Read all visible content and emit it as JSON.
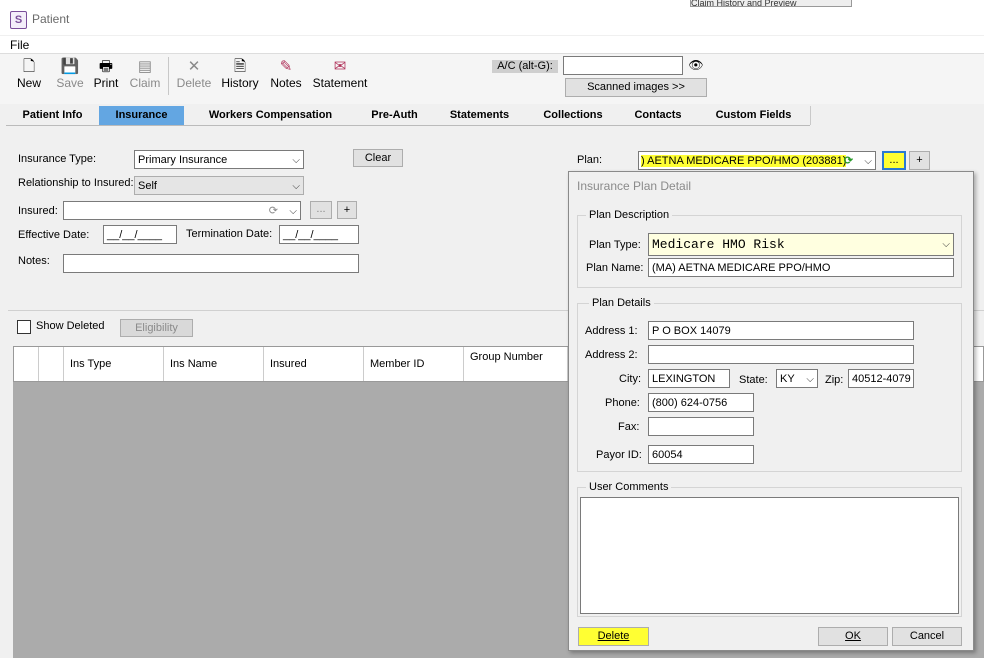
{
  "window": {
    "title": "Patient",
    "background_tab": "Claim History and Preview"
  },
  "menu": {
    "file": "File"
  },
  "toolbar": {
    "new": "New",
    "save": "Save",
    "print": "Print",
    "claim": "Claim",
    "delete": "Delete",
    "history": "History",
    "notes": "Notes",
    "statement": "Statement",
    "ac_label": "A/C (alt-G):",
    "ac_value": "",
    "scanned_images": "Scanned images >>"
  },
  "tabs": [
    "Patient Info",
    "Insurance",
    "Workers Compensation",
    "Pre-Auth",
    "Statements",
    "Collections",
    "Contacts",
    "Custom Fields"
  ],
  "active_tab": "Insurance",
  "form": {
    "insurance_type_label": "Insurance Type:",
    "insurance_type_value": "Primary Insurance",
    "clear_button": "Clear",
    "relationship_label": "Relationship to Insured:",
    "relationship_value": "Self",
    "insured_label": "Insured:",
    "insured_value": "",
    "effective_date_label": "Effective Date:",
    "effective_date_value": "__/__/____",
    "termination_date_label": "Termination Date:",
    "termination_date_value": "__/__/____",
    "notes_label": "Notes:",
    "notes_value": "",
    "plan_label": "Plan:",
    "plan_value": ") AETNA MEDICARE PPO/HMO (203881)",
    "ellipsis": "...",
    "plus": "+",
    "show_deleted_label": "Show Deleted",
    "eligibility_button": "Eligibility"
  },
  "grid": {
    "columns": [
      "",
      "",
      "Ins Type",
      "Ins Name",
      "Insured",
      "Member ID",
      "Group Number"
    ]
  },
  "dialog": {
    "title": "Insurance Plan Detail",
    "plan_description_legend": "Plan Description",
    "plan_type_label": "Plan Type:",
    "plan_type_value": "Medicare HMO Risk",
    "plan_name_label": "Plan Name:",
    "plan_name_value": "(MA) AETNA MEDICARE PPO/HMO",
    "plan_details_legend": "Plan Details",
    "address1_label": "Address 1:",
    "address1_value": "P O BOX 14079",
    "address2_label": "Address 2:",
    "address2_value": "",
    "city_label": "City:",
    "city_value": "LEXINGTON",
    "state_label": "State:",
    "state_value": "KY",
    "zip_label": "Zip:",
    "zip_value": "40512-4079",
    "phone_label": "Phone:",
    "phone_value": "(800) 624-0756",
    "fax_label": "Fax:",
    "fax_value": "",
    "payor_id_label": "Payor ID:",
    "payor_id_value": "60054",
    "user_comments_legend": "User Comments",
    "user_comments_value": "",
    "delete_button": "Delete",
    "ok_button": "OK",
    "cancel_button": "Cancel"
  },
  "colors": {
    "active_tab": "#63a6e2",
    "highlight": "#ffff33",
    "grid_bg": "#ababab",
    "plan_type_bg": "#ffffe0"
  },
  "icons": {
    "new": "new-document-icon",
    "save": "save-icon",
    "print": "printer-icon",
    "claim": "claim-icon",
    "delete": "delete-x-icon",
    "history": "history-icon",
    "notes": "notes-icon",
    "statement": "statement-icon",
    "search": "binoculars-icon",
    "refresh": "refresh-icon"
  }
}
